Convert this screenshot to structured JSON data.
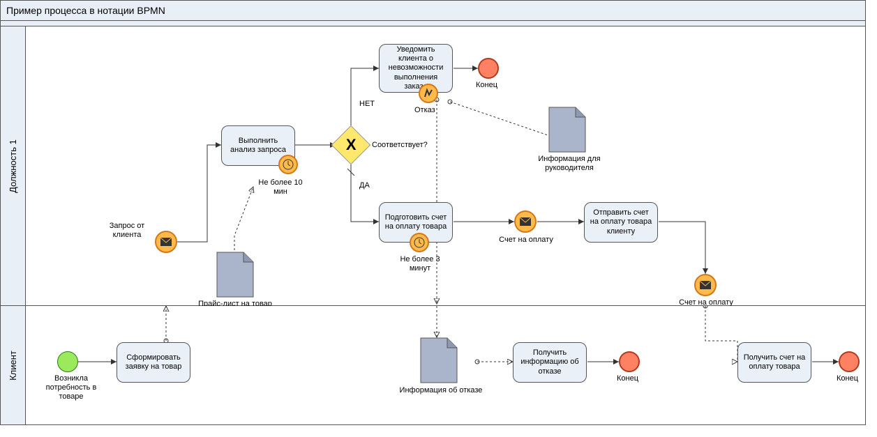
{
  "pool_title": "Пример процесса в нотации BPMN",
  "lane1": {
    "name": "Должность 1"
  },
  "lane2": {
    "name": "Клиент"
  },
  "events": {
    "start_need": "Возникла потребность в товаре",
    "request_from_client": "Запрос от клиента",
    "end1": "Конец",
    "end2": "Конец",
    "end3": "Конец",
    "invoice_msg": "Счет на оплату",
    "invoice_msg2": "Счет на оплату",
    "refusal": "Отказ"
  },
  "tasks": {
    "form_request": "Сформировать заявку на товар",
    "analyze": "Выполнить анализ запроса",
    "notify_impossible": "Уведомить клиента о невозможности выполнения заказа",
    "prepare_invoice": "Подготовить счет на оплату товара",
    "send_invoice": "Отправить счет на оплату товара клиенту",
    "receive_refusal": "Получить информацию об отказе",
    "receive_invoice": "Получить счет на оплату товара"
  },
  "gateway": {
    "label": "Соответствует?",
    "yes": "ДА",
    "no": "НЕТ"
  },
  "timers": {
    "t1": "Не более 10 мин",
    "t2": "Не более 3 минут"
  },
  "docs": {
    "price_list": "Прайс-лист на товар",
    "mgr_info": "Информация для руководителя",
    "refusal_info": "Информация об отказе"
  }
}
